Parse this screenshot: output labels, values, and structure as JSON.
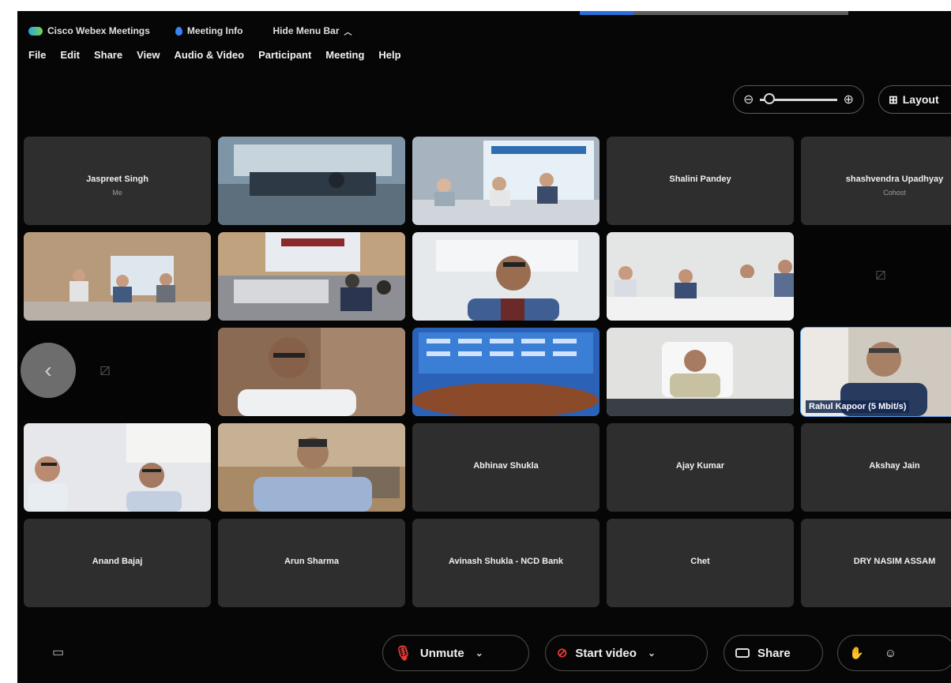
{
  "window": {
    "app_title": "Cisco Webex Meetings",
    "meeting_info": "Meeting Info",
    "hide_menu": "Hide Menu Bar",
    "progress": 0.2
  },
  "menu": [
    "File",
    "Edit",
    "Share",
    "View",
    "Audio & Video",
    "Participant",
    "Meeting",
    "Help"
  ],
  "toolbar": {
    "layout_label": "Layout",
    "zoom_level": 0.05
  },
  "tiles": [
    {
      "name": "Jaspreet Singh",
      "sub": "Me",
      "type": "name"
    },
    {
      "type": "video",
      "scene": "room"
    },
    {
      "type": "video",
      "scene": "banner-table"
    },
    {
      "name": "Shalini Pandey",
      "type": "name"
    },
    {
      "name": "shashvendra Upadhyay",
      "sub": "Cohost",
      "type": "name"
    },
    {
      "type": "video",
      "scene": "conference"
    },
    {
      "type": "video",
      "scene": "hall"
    },
    {
      "type": "video",
      "scene": "person-glasses"
    },
    {
      "type": "video",
      "scene": "table-row"
    },
    {
      "type": "camoff"
    },
    {
      "type": "camoff-left"
    },
    {
      "type": "video",
      "scene": "closeup"
    },
    {
      "type": "video",
      "scene": "blue-stage"
    },
    {
      "type": "video",
      "scene": "desk-man"
    },
    {
      "type": "video",
      "scene": "speaker",
      "overlay": "Rahul Kapoor (5 Mbit/s)",
      "active": true
    },
    {
      "type": "video",
      "scene": "two-men"
    },
    {
      "type": "video",
      "scene": "young-man"
    },
    {
      "name": "Abhinav Shukla",
      "type": "name"
    },
    {
      "name": "Ajay Kumar",
      "type": "name"
    },
    {
      "name": "Akshay Jain",
      "type": "name"
    },
    {
      "name": "Anand Bajaj",
      "type": "name"
    },
    {
      "name": "Arun Sharma",
      "type": "name"
    },
    {
      "name": "Avinash Shukla - NCD Bank",
      "type": "name"
    },
    {
      "name": "Chet",
      "type": "name"
    },
    {
      "name": "DRY NASIM ASSAM",
      "type": "name"
    }
  ],
  "controls": {
    "unmute": "Unmute",
    "start_video": "Start video",
    "share": "Share"
  }
}
